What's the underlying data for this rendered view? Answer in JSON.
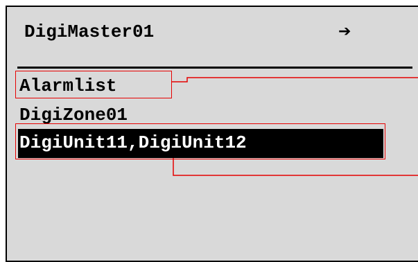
{
  "header": {
    "title": "DigiMaster01",
    "arrow_icon": "right-arrow-icon"
  },
  "menu": {
    "items": [
      {
        "label": "Alarmlist",
        "selected": false
      },
      {
        "label": "DigiZone01",
        "selected": false
      },
      {
        "label": "DigiUnit11,DigiUnit12",
        "selected": true
      }
    ]
  },
  "colors": {
    "screen_background": "#d9d9d9",
    "text": "#000000",
    "selection_background": "#000000",
    "selection_text": "#ffffff",
    "callout": "#e60000"
  }
}
